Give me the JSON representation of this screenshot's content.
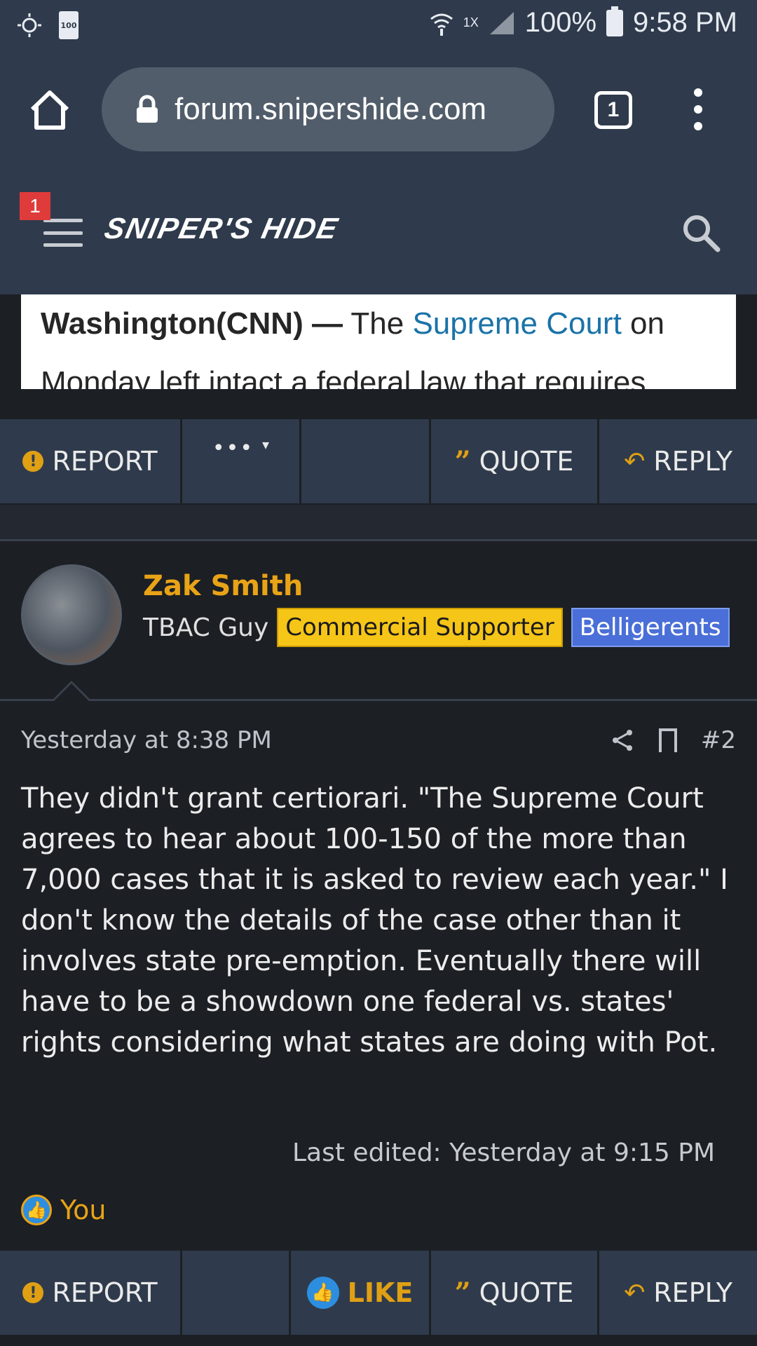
{
  "status_bar": {
    "battery_small": "100",
    "network_badge": "1X",
    "battery_percent": "100%",
    "time": "9:58 PM"
  },
  "browser": {
    "url": "forum.snipershide.com",
    "tab_count": "1"
  },
  "site_header": {
    "notification_count": "1",
    "logo_text": "SNIPER'S HIDE"
  },
  "embed": {
    "bold_lead": "Washington(CNN) —",
    "text_after_lead": " The ",
    "link_text": "Supreme Court",
    "text_rest": " on Monday left intact a federal law that requires"
  },
  "action_bar_top": {
    "report": "REPORT",
    "more": "•••",
    "quote": "QUOTE",
    "reply": "REPLY"
  },
  "post": {
    "author": "Zak Smith",
    "user_title": "TBAC Guy",
    "badge_1": "Commercial Supporter",
    "badge_2": "Belligerents",
    "timestamp": "Yesterday at 8:38 PM",
    "post_number": "#2",
    "body": "They didn't grant certiorari. \"The Supreme Court agrees to hear about 100-150 of the more than 7,000 cases that it is asked to review each year.\" I don't know the details of the case other than it involves state pre-emption. Eventually there will have to be a showdown one federal vs. states' rights considering what states are doing with Pot.",
    "last_edited": "Last edited: Yesterday at 9:15 PM",
    "reaction_user": "You"
  },
  "action_bar_bottom": {
    "report": "REPORT",
    "like": "LIKE",
    "quote": "QUOTE",
    "reply": "REPLY"
  },
  "colors": {
    "header_bg": "#2f3b4c",
    "accent_gold": "#e8a317",
    "badge_yellow": "#f5c518",
    "badge_blue": "#4a6fd8",
    "like_blue": "#2d8ee0",
    "link_blue": "#1a73a8"
  }
}
